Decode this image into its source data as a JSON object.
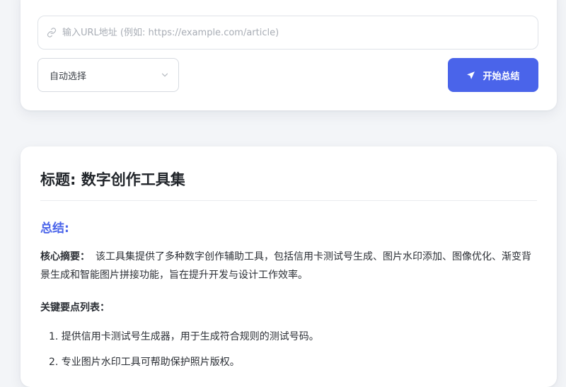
{
  "input": {
    "url_placeholder": "输入URL地址 (例如: https://example.com/article)",
    "url_value": "",
    "select_value": "自动选择",
    "submit_label": "开始总结"
  },
  "result": {
    "title": "标题: 数字创作工具集",
    "summary_heading": "总结:",
    "core_label": "核心摘要：",
    "core_text": "该工具集提供了多种数字创作辅助工具，包括信用卡测试号生成、图片水印添加、图像优化、渐变背景生成和智能图片拼接功能，旨在提升开发与设计工作效率。",
    "key_points_heading": "关键要点列表：",
    "key_points": [
      "1. 提供信用卡测试号生成器，用于生成符合规则的测试号码。",
      "2. 专业图片水印工具可帮助保护照片版权。"
    ]
  },
  "colors": {
    "accent": "#4a64ea",
    "page_bg": "#f3f5f8",
    "card_bg": "#ffffff"
  },
  "icons": {
    "url": "link-icon",
    "select": "chevron-down-icon",
    "submit": "send-icon"
  }
}
